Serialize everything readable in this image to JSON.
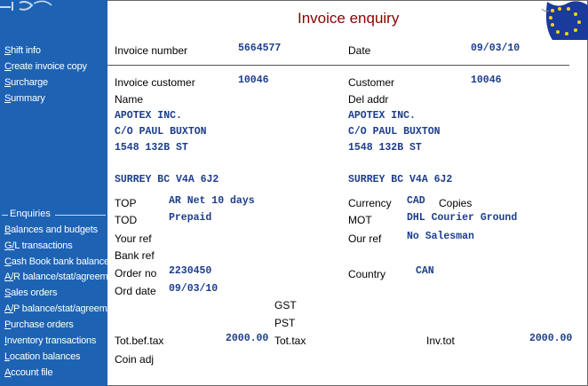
{
  "window": {
    "title": "Invoice enquiry"
  },
  "sidebar": {
    "actions": [
      "Shift info",
      "Create invoice copy",
      "Surcharge",
      "Summary"
    ],
    "enquiries_heading": "Enquiries",
    "enquiries": [
      "Balances and budgets",
      "G/L transactions",
      "Cash Book bank balances",
      "A/R balance/stat/agreem/tran",
      "Sales orders",
      "A/P balance/stat/agreem/tran",
      "Purchase orders",
      "Inventory transactions",
      "Location balances",
      "Account file"
    ]
  },
  "invoice": {
    "invoice_number_label": "Invoice number",
    "invoice_number": "5664577",
    "date_label": "Date",
    "date": "09/03/10",
    "invoice_customer_label": "Invoice customer",
    "invoice_customer": "10046",
    "customer_label": "Customer",
    "customer": "10046",
    "name_label": "Name",
    "del_addr_label": "Del addr",
    "bill_to": [
      "APOTEX INC.",
      "C/O PAUL BUXTON",
      "1548 132B ST",
      "SURREY BC V4A 6J2"
    ],
    "ship_to": [
      "APOTEX INC.",
      "C/O PAUL BUXTON",
      "1548 132B ST",
      "SURREY BC V4A 6J2"
    ],
    "top_label": "TOP",
    "top": "AR Net 10 days",
    "tod_label": "TOD",
    "tod": "Prepaid",
    "your_ref_label": "Your ref",
    "bank_ref_label": "Bank ref",
    "order_no_label": "Order no",
    "order_no": "2230450",
    "ord_date_label": "Ord date",
    "ord_date": "09/03/10",
    "currency_label": "Currency",
    "currency": "CAD",
    "copies_label": "Copies",
    "mot_label": "MOT",
    "mot": "DHL Courier Ground",
    "our_ref_label": "Our ref",
    "our_ref": "No Salesman",
    "country_label": "Country",
    "country": "CAN",
    "gst_label": "GST",
    "pst_label": "PST",
    "tot_bef_tax_label": "Tot.bef.tax",
    "tot_bef_tax": "2000.00",
    "tot_tax_label": "Tot.tax",
    "inv_tot_label": "Inv.tot",
    "inv_tot": "2000.00",
    "coin_adj_label": "Coin adj"
  },
  "colors": {
    "sidebar_bg": "#1e62b3",
    "title": "#8b0000",
    "value_text": "#1c3d8c"
  }
}
